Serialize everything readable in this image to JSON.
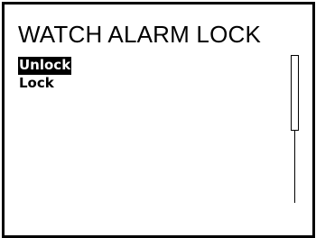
{
  "screen": {
    "title": "WATCH ALARM LOCK"
  },
  "menu": {
    "items": [
      {
        "label": "Unlock",
        "selected": true
      },
      {
        "label": "Lock",
        "selected": false
      }
    ]
  },
  "scrollbar": {
    "visible_fraction": 0.5,
    "position": 0
  },
  "colors": {
    "background": "#ffffff",
    "foreground": "#000000",
    "highlight_background": "#000000",
    "highlight_text": "#ffffff"
  }
}
